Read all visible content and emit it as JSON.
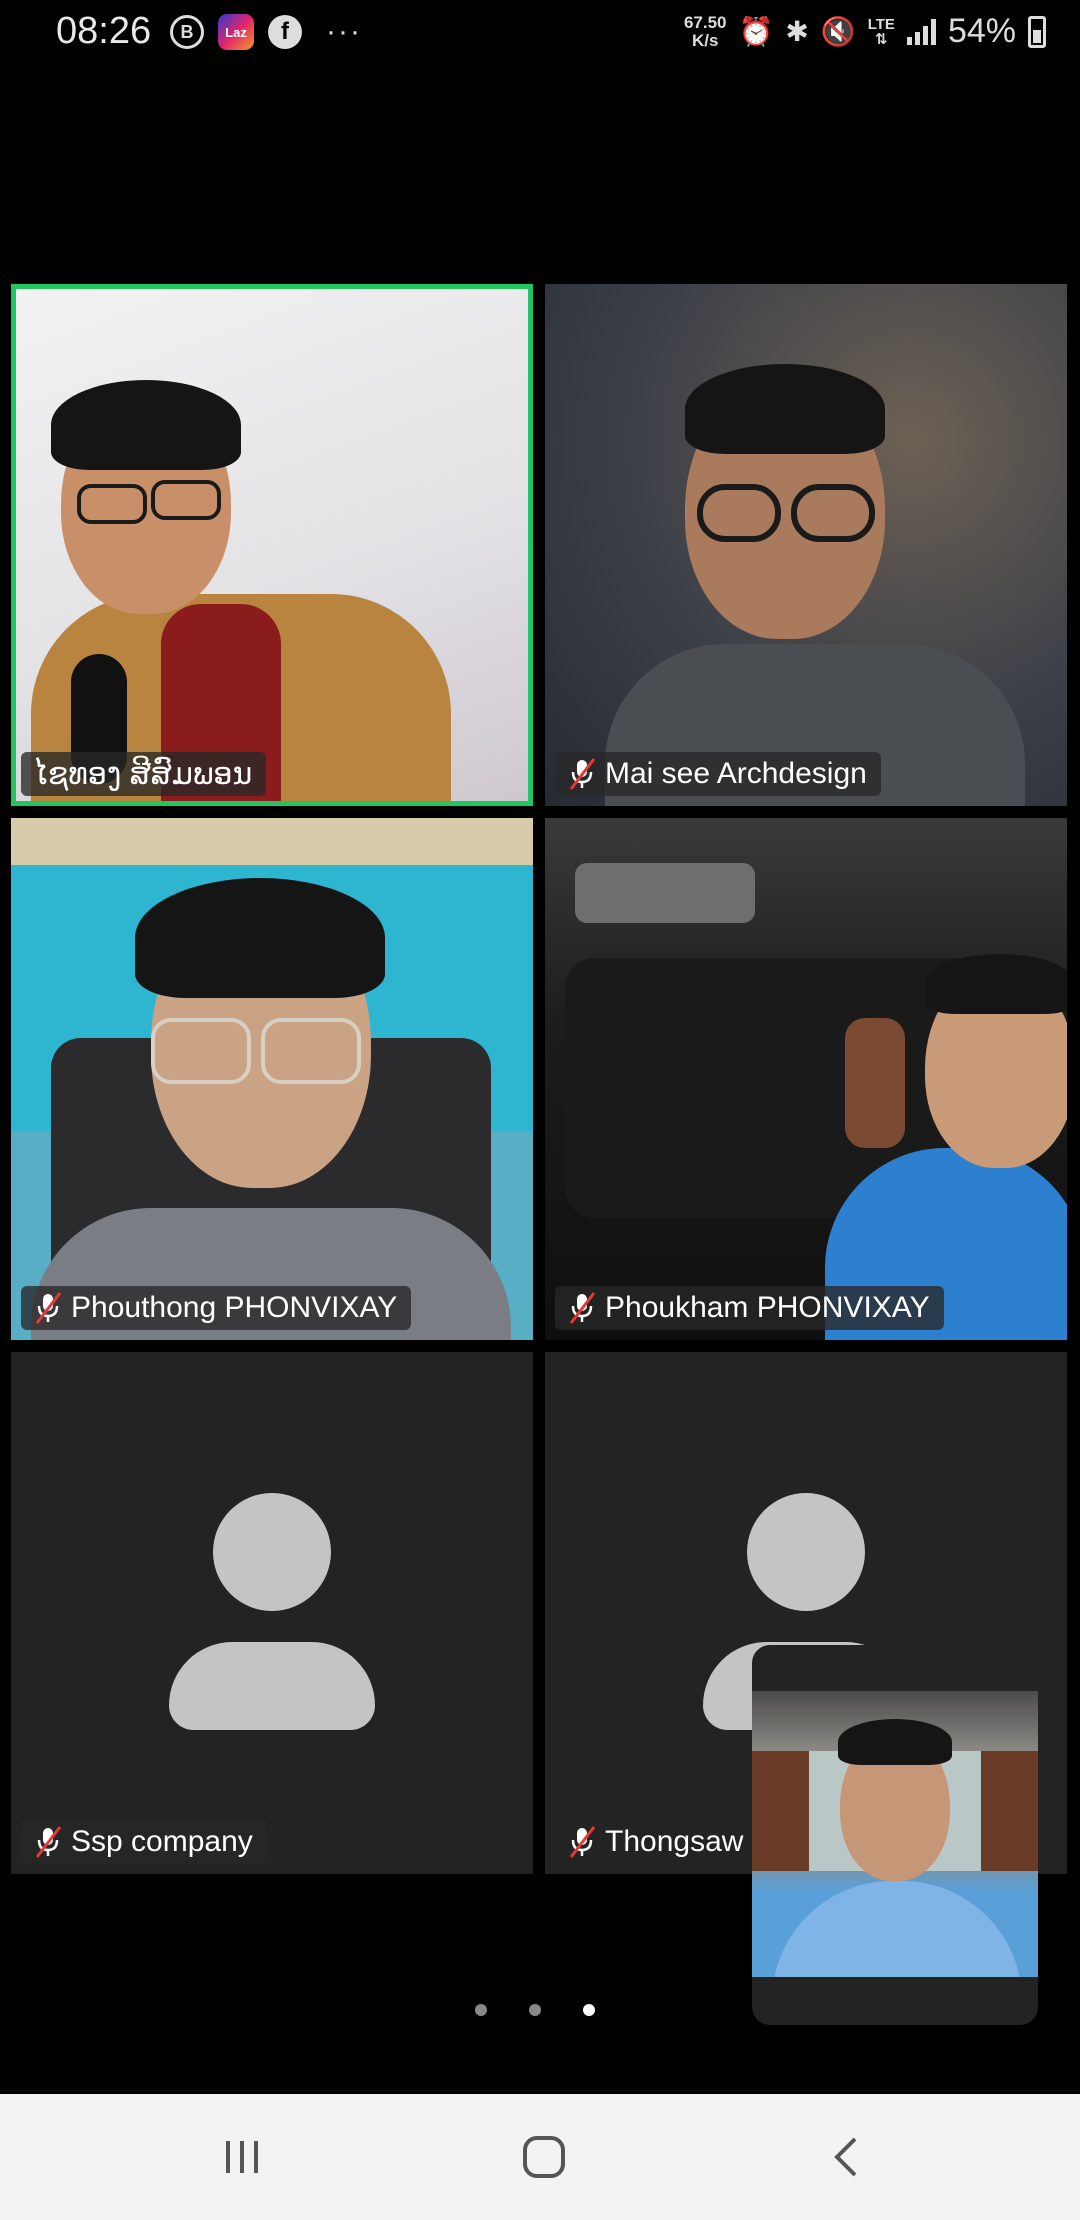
{
  "status_bar": {
    "time": "08:26",
    "left_icons": [
      "b-circle-icon",
      "lazada-icon",
      "facebook-icon",
      "more-dots-icon"
    ],
    "more_dots": "···",
    "net_speed_value": "67.50",
    "net_speed_unit": "K/s",
    "right_icons": [
      "alarm-icon",
      "bluetooth-icon",
      "mute-icon",
      "lte-icon",
      "signal-icon",
      "battery-icon"
    ],
    "lte": "LTE",
    "battery": "54%"
  },
  "participants": [
    {
      "name": "ໄຊທອງ ສີສົມພອນ",
      "muted": false,
      "active_speaker": true,
      "video": true
    },
    {
      "name": "Mai see Archdesign",
      "muted": true,
      "active_speaker": false,
      "video": true
    },
    {
      "name": "Phouthong PHONVIXAY",
      "muted": true,
      "active_speaker": false,
      "video": true
    },
    {
      "name": "Phoukham PHONVIXAY",
      "muted": true,
      "active_speaker": false,
      "video": true
    },
    {
      "name": "Ssp company",
      "muted": true,
      "active_speaker": false,
      "video": false
    },
    {
      "name": "Thongsaw",
      "muted": true,
      "active_speaker": false,
      "video": false
    }
  ],
  "pagination": {
    "pages": 3,
    "current": 3
  },
  "colors": {
    "active_speaker_border": "#22c55e",
    "tile_bg": "#232323",
    "avatar": "#c4c4c4",
    "mute_slash": "#e53935"
  }
}
